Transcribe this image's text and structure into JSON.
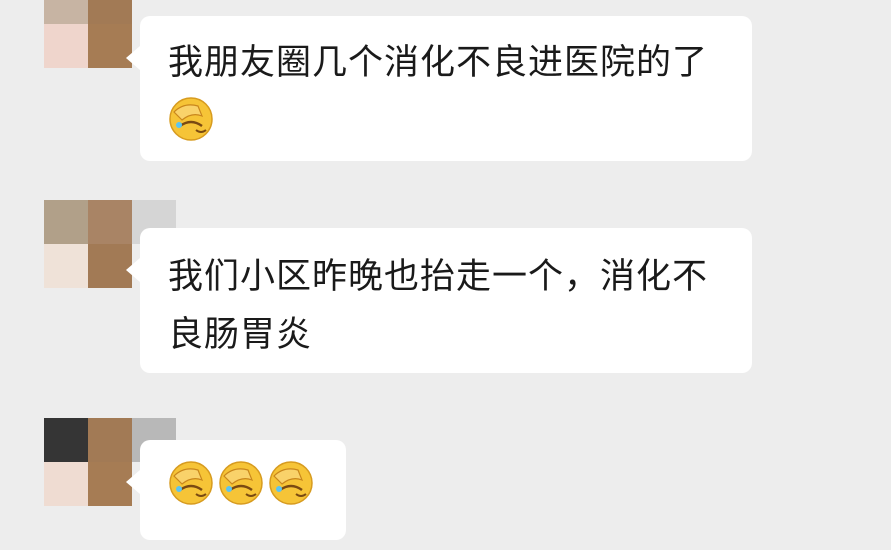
{
  "messages": [
    {
      "text": "我朋友圈几个消化不良进医院的了",
      "emoji": [
        "facepalm-emoji"
      ]
    },
    {
      "text": "我们小区昨晚也抬走一个，消化不\n良肠胃炎",
      "emoji": []
    },
    {
      "text": "",
      "emoji": [
        "facepalm-emoji",
        "facepalm-emoji",
        "facepalm-emoji"
      ]
    }
  ],
  "colors": {
    "background": "#ededed",
    "bubble": "#ffffff",
    "text": "#1a1a1a",
    "emoji_face": "#f6c437"
  }
}
